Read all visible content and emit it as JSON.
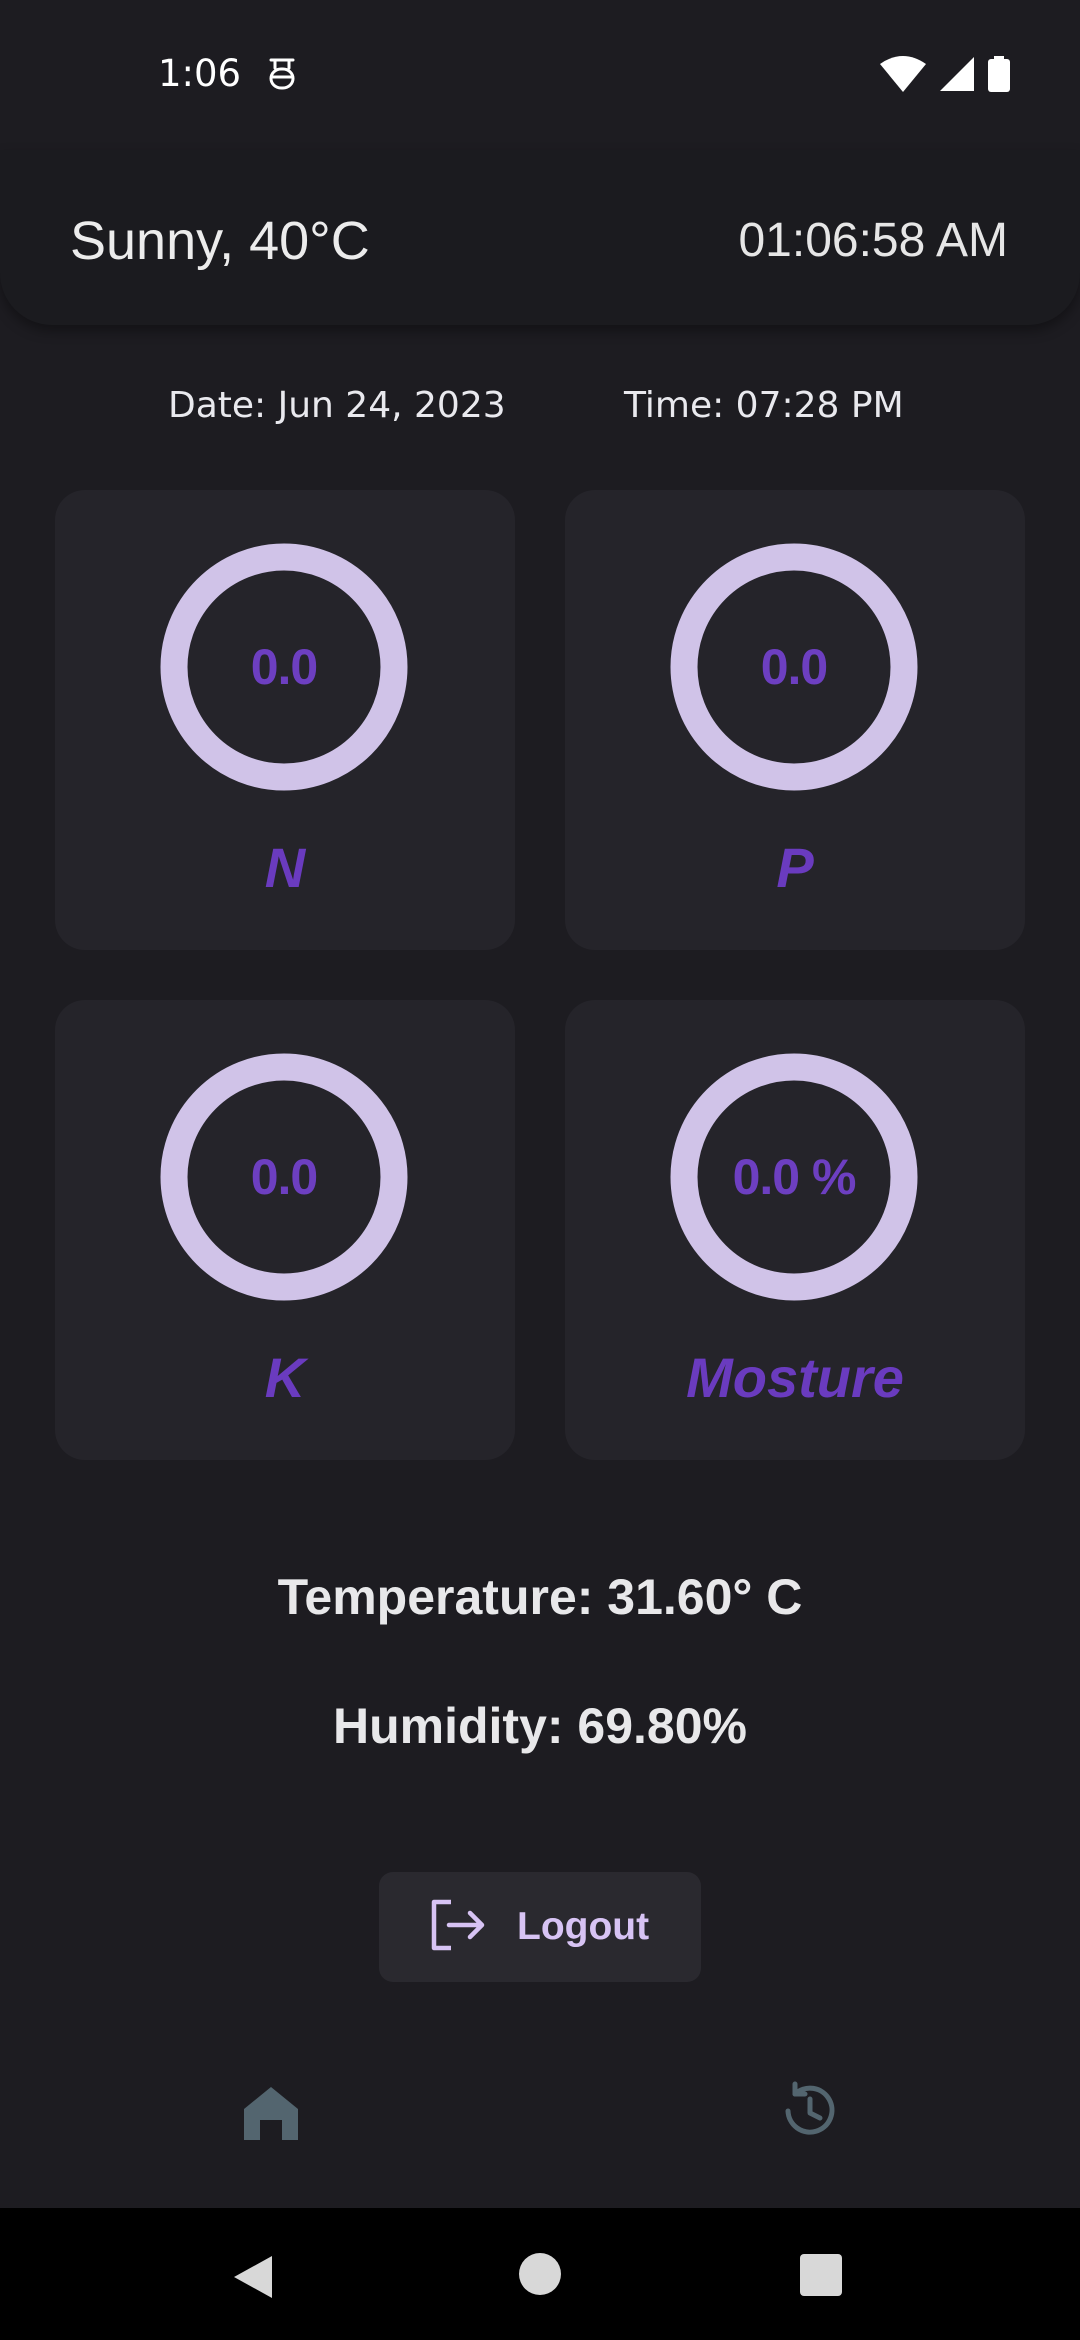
{
  "status_bar": {
    "time": "1:06"
  },
  "header": {
    "weather": "Sunny, 40°C",
    "clock": "01:06:58 AM"
  },
  "info_row": {
    "date": "Date: Jun 24, 2023",
    "time": "Time: 07:28 PM"
  },
  "gauges": {
    "n": {
      "value": "0.0",
      "label": "N"
    },
    "p": {
      "value": "0.0",
      "label": "P"
    },
    "k": {
      "value": "0.0",
      "label": "K"
    },
    "moisture": {
      "value": "0.0 %",
      "label": "Mosture"
    }
  },
  "readings": {
    "temperature": "Temperature: 31.60° C",
    "humidity": "Humidity: 69.80%"
  },
  "logout": {
    "label": "Logout",
    "icon": "logout-icon"
  },
  "bottom_nav": {
    "items": [
      {
        "icon": "home-icon",
        "active": true
      },
      {
        "icon": "history-icon",
        "active": false
      }
    ]
  },
  "colors": {
    "background": "#1d1c21",
    "card": "#25242a",
    "gauge_ring": "#d0c3e8",
    "accent_text": "#6d3fc1",
    "logout_text": "#d7c3f4",
    "nav_icon": "#53656f"
  }
}
